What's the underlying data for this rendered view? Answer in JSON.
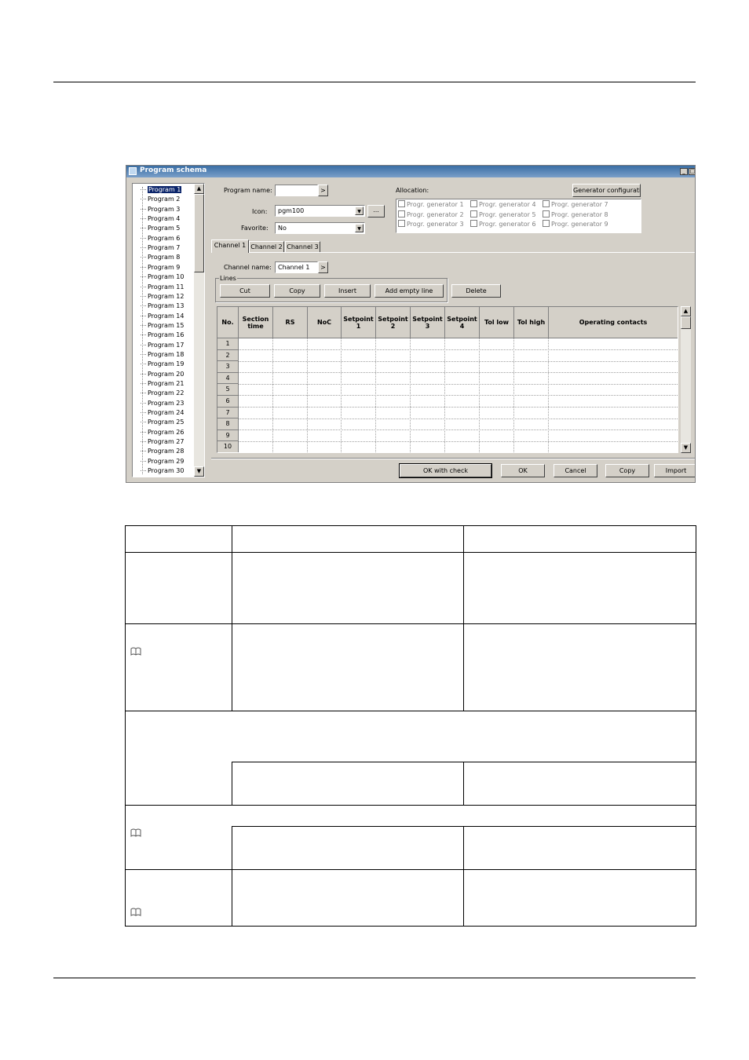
{
  "window": {
    "title": "Program schema",
    "tb_min": "_",
    "tb_max": "□"
  },
  "tree": {
    "items": [
      "Program 1",
      "Program 2",
      "Program 3",
      "Program 4",
      "Program 5",
      "Program 6",
      "Program 7",
      "Program 8",
      "Program 9",
      "Program 10",
      "Program 11",
      "Program 12",
      "Program 13",
      "Program 14",
      "Program 15",
      "Program 16",
      "Program 17",
      "Program 18",
      "Program 19",
      "Program 20",
      "Program 21",
      "Program 22",
      "Program 23",
      "Program 24",
      "Program 25",
      "Program 26",
      "Program 27",
      "Program 28",
      "Program 29",
      "Program 30"
    ],
    "selected": "Program 1"
  },
  "form": {
    "program_name_label": "Program name:",
    "program_name_value": "",
    "browse_btn": ">",
    "icon_label": "Icon:",
    "icon_value": "pgm100",
    "icon_more_btn": "...",
    "favorite_label": "Favorite:",
    "favorite_value": "No"
  },
  "allocation": {
    "label": "Allocation:",
    "gen_config_btn": "Generator configuration",
    "generators": [
      "Progr. generator 1",
      "Progr. generator 2",
      "Progr. generator 3",
      "Progr. generator 4",
      "Progr. generator 5",
      "Progr. generator 6",
      "Progr. generator 7",
      "Progr. generator 8",
      "Progr. generator 9"
    ]
  },
  "tabs": [
    "Channel 1",
    "Channel 2",
    "Channel 3"
  ],
  "channel": {
    "name_label": "Channel name:",
    "name_value": "Channel 1",
    "name_btn": ">"
  },
  "lines": {
    "group_label": "Lines",
    "cut": "Cut",
    "copy": "Copy",
    "insert": "Insert",
    "add_empty": "Add empty line",
    "delete": "Delete"
  },
  "grid": {
    "headers": [
      "No.",
      "Section time",
      "RS",
      "NoC",
      "Setpoint 1",
      "Setpoint 2",
      "Setpoint 3",
      "Setpoint 4",
      "Tol low",
      "Tol high",
      "Operating contacts"
    ],
    "rows": [
      "1",
      "2",
      "3",
      "4",
      "5",
      "6",
      "7",
      "8",
      "9",
      "10"
    ]
  },
  "footer_buttons": {
    "ok_check": "OK with check",
    "ok": "OK",
    "cancel": "Cancel",
    "copy": "Copy",
    "import": "Import"
  },
  "scroll": {
    "up": "▲",
    "down": "▼"
  }
}
